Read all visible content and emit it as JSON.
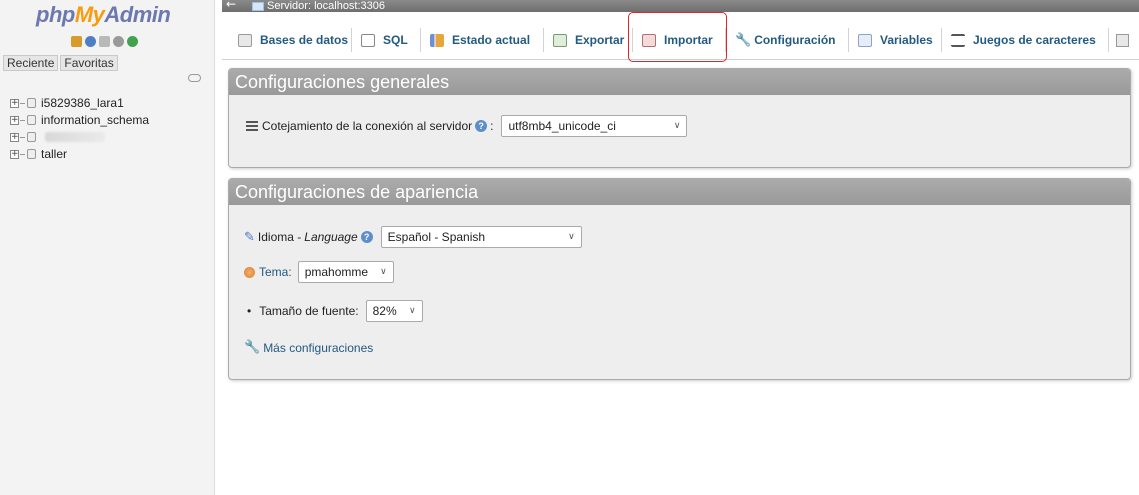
{
  "nav": {
    "logo": {
      "part1": "php",
      "part2": "My",
      "part3": "Admin"
    },
    "icons": [
      "home-icon",
      "logout-icon",
      "docs-icon",
      "settings-icon",
      "reload-icon"
    ],
    "tabs": {
      "recent": "Reciente",
      "favorites": "Favoritas"
    },
    "databases": [
      {
        "name": "i5829386_lara1"
      },
      {
        "name": "information_schema"
      },
      {
        "name": ""
      },
      {
        "name": "taller"
      }
    ]
  },
  "breadcrumb": {
    "collapse": "←",
    "server": "Servidor: localhost:3306"
  },
  "menu": {
    "tabs": [
      {
        "label": "Bases de datos"
      },
      {
        "label": "SQL"
      },
      {
        "label": "Estado actual"
      },
      {
        "label": "Exportar"
      },
      {
        "label": "Importar"
      },
      {
        "label": "Configuración"
      },
      {
        "label": "Variables"
      },
      {
        "label": "Juegos de caracteres"
      }
    ],
    "highlighted": "Importar",
    "highlight_color": "#e0262a"
  },
  "general": {
    "title": "Configuraciones generales",
    "collation_label": "Cotejamiento de la conexión al servidor",
    "collation_suffix": ":",
    "collation_value": "utf8mb4_unicode_ci"
  },
  "appearance": {
    "title": "Configuraciones de apariencia",
    "language_label": "Idioma - ",
    "language_label_em": "Language",
    "language_value": "Español - Spanish",
    "theme_label": "Tema:",
    "theme_value": "pmahomme",
    "font_label": "Tamaño de fuente:",
    "font_value": "82%",
    "more_link": "Más configuraciones"
  },
  "colors": {
    "link": "#235a81",
    "header": "#999999"
  }
}
